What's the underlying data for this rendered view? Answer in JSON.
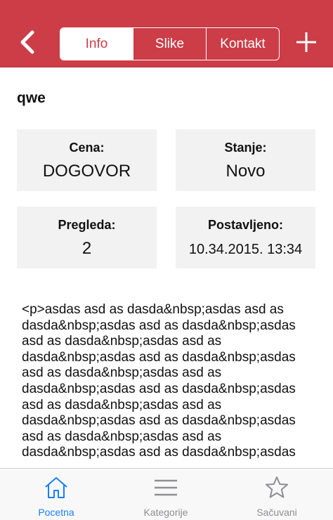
{
  "nav": {
    "segments": [
      "Info",
      "Slike",
      "Kontakt"
    ],
    "active_segment": "Info",
    "back_icon": "chevron-left-icon",
    "add_icon": "plus-icon"
  },
  "listing": {
    "title": "qwe",
    "price": {
      "label": "Cena:",
      "value": "DOGOVOR"
    },
    "condition": {
      "label": "Stanje:",
      "value": "Novo"
    },
    "views": {
      "label": "Pregleda:",
      "value": "2"
    },
    "posted": {
      "label": "Postavljeno:",
      "value": "10.34.2015. 13:34"
    },
    "description_lines": [
      "<p>asdas asd as dasda&nbsp;asdas asd as",
      "dasda&nbsp;asdas asd as dasda&nbsp;asdas",
      "asd as dasda&nbsp;asdas asd as",
      "dasda&nbsp;asdas asd as dasda&nbsp;asdas",
      "asd as dasda&nbsp;asdas asd as",
      "dasda&nbsp;asdas asd as dasda&nbsp;asdas",
      "asd as dasda&nbsp;asdas asd as",
      "dasda&nbsp;asdas asd as dasda&nbsp;asdas",
      "asd as dasda&nbsp;asdas asd as",
      "dasda&nbsp;asdas asd as dasda&nbsp;asdas"
    ]
  },
  "tabbar": {
    "items": [
      {
        "label": "Pocetna",
        "icon": "home-icon",
        "active": true
      },
      {
        "label": "Kategorije",
        "icon": "menu-icon",
        "active": false
      },
      {
        "label": "Sačuvani",
        "icon": "star-icon",
        "active": false
      }
    ]
  },
  "colors": {
    "brand": "#cc3d47",
    "active_tab": "#1a7ef5",
    "inactive_tab": "#8e8e93",
    "card_bg": "#f2f2f2"
  }
}
